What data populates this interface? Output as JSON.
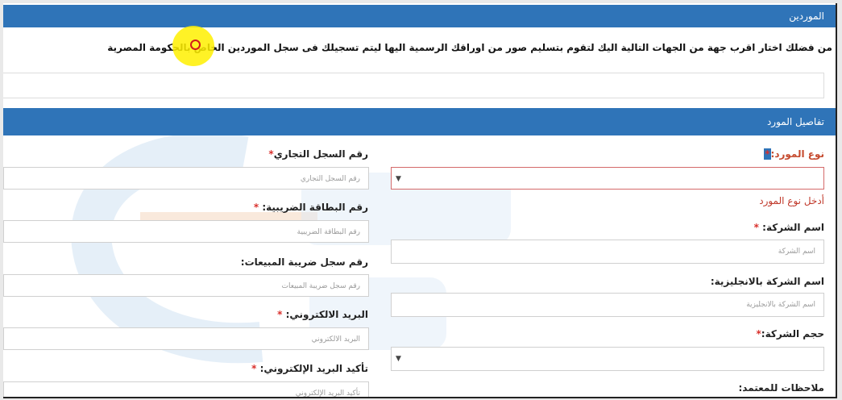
{
  "header": {
    "title": "الموردين"
  },
  "instruction": "من فضلك اختار اقرب جهة من الجهات التالية اليك لتقوم بتسليم صور من اوراقك الرسمية اليها ليتم تسجيلك فى سجل الموردين الخاص بالحكومة المصرية",
  "section": {
    "title": "تفاصيل المورد"
  },
  "colors": {
    "accent": "#2f74b8",
    "required": "#d9302c",
    "error": "#c0392b",
    "highlight": "#fff000"
  },
  "right_column": {
    "supplier_type": {
      "label": "نوع المورد:",
      "star": "*",
      "error": "أدخل نوع المورد",
      "arrow": "▼"
    },
    "company_name": {
      "label": "اسم الشركة:",
      "star": "*",
      "placeholder": "اسم الشركة"
    },
    "company_name_en": {
      "label": "اسم الشركة بالانجليزية:",
      "placeholder": "اسم الشركة بالانجليزية"
    },
    "company_size": {
      "label": "حجم الشركة:",
      "star": "*",
      "arrow": "▼"
    },
    "notes": {
      "label": "ملاحظات للمعتمد:"
    }
  },
  "left_column": {
    "commercial_register": {
      "label": "رقم السجل التجاري",
      "star": "*",
      "placeholder": "رقم السجل التجاري"
    },
    "tax_card": {
      "label": "رقم البطاقة الضريبية:",
      "star": "*",
      "placeholder": "رقم البطاقة الضريبية"
    },
    "sales_tax": {
      "label": "رقم سجل ضريبة المبيعات:",
      "placeholder": "رقم سجل ضريبة المبيعات"
    },
    "email": {
      "label": "البريد الالكتروني:",
      "star": "*",
      "placeholder": "البريد الالكتروني"
    },
    "email_confirm": {
      "label": "تأكيد البريد الإلكتروني:",
      "star": "*",
      "placeholder": "تأكيد البريد الإلكتروني"
    }
  }
}
